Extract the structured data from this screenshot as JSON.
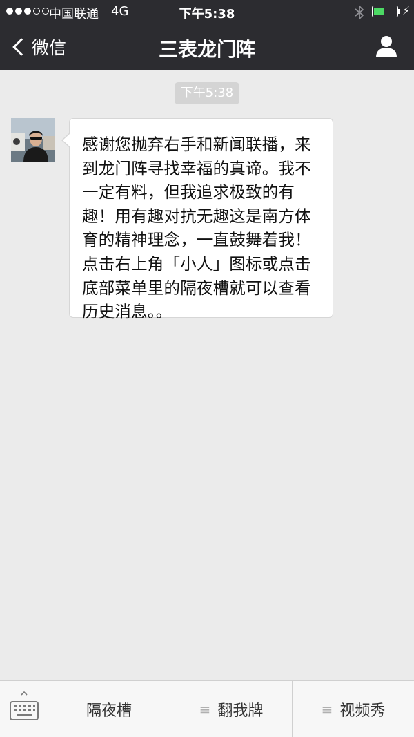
{
  "status_bar": {
    "carrier": "中国联通",
    "network": "4G",
    "time": "下午5:38",
    "signal_bars_filled": 3,
    "signal_bars_total": 5,
    "battery_level": 0.45,
    "battery_color": "#4cd964"
  },
  "nav": {
    "back_label": "微信",
    "title": "三表龙门阵",
    "profile_icon": "person-icon"
  },
  "chat": {
    "timestamp": "下午5:38",
    "messages": [
      {
        "sender": "official-account",
        "text": "感谢您抛弃右手和新闻联播，来到龙门阵寻找幸福的真谛。我不一定有料，但我追求极致的有趣！用有趣对抗无趣这是南方体育的精神理念，一直鼓舞着我！点击右上角「小人」图标或点击底部菜单里的隔夜槽就可以查看历史消息。。"
      }
    ]
  },
  "bottom_menu": {
    "keyboard_icon": "keyboard-icon",
    "items": [
      {
        "label": "隔夜槽",
        "has_submenu": false
      },
      {
        "label": "翻我牌",
        "has_submenu": true
      },
      {
        "label": "视频秀",
        "has_submenu": true
      }
    ],
    "submenu_icon": "≡"
  },
  "colors": {
    "topbar_bg": "#2c2c30",
    "chat_bg": "#ebebeb",
    "bubble_bg": "#ffffff",
    "menu_bg": "#f7f7f7"
  }
}
